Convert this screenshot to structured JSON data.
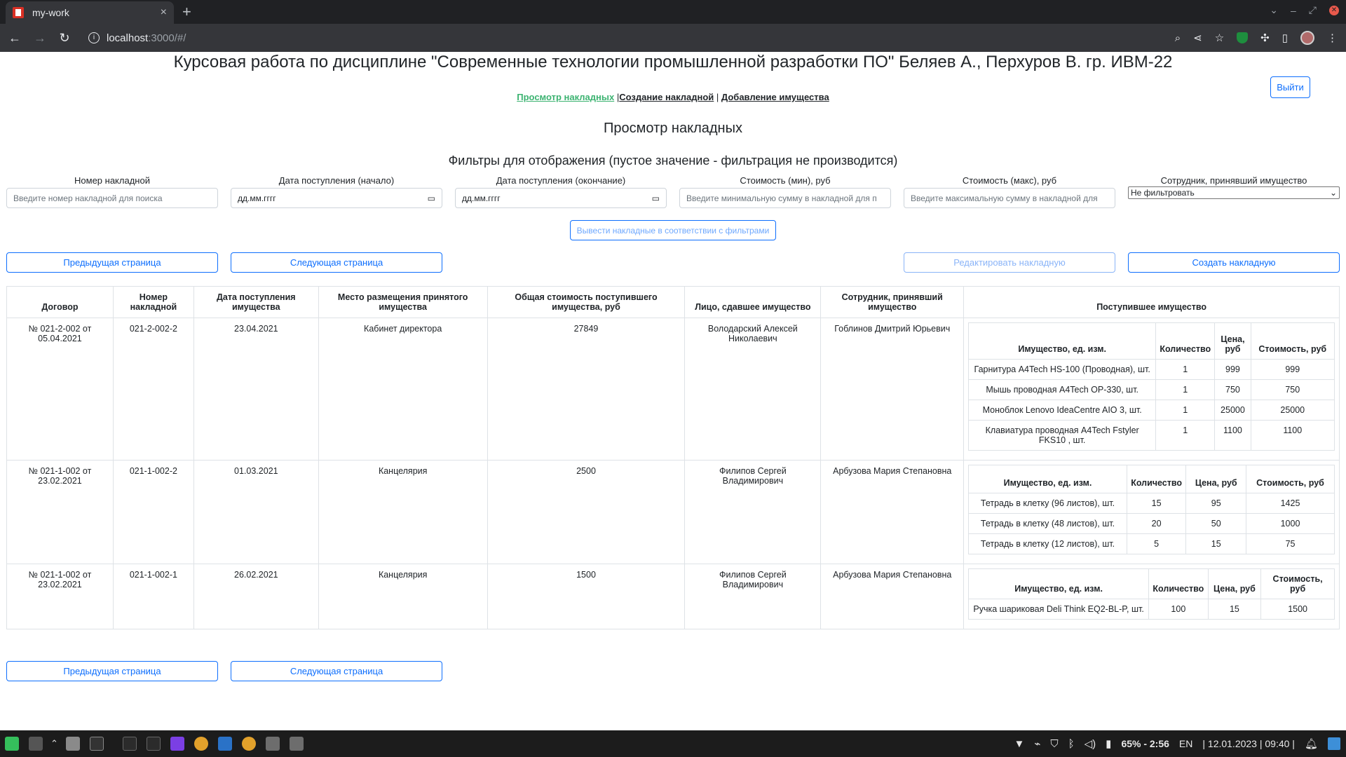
{
  "browser": {
    "tab_title": "my-work",
    "tab_close": "×",
    "new_tab": "+",
    "url_host": "localhost",
    "url_path": ":3000/#/"
  },
  "page": {
    "title": "Курсовая работа по дисциплине \"Современные технологии промышленной разработки ПО\" Беляев А., Перхуров В. гр. ИВМ-22",
    "logout_label": "Выйти",
    "nav": {
      "view": "Просмотр накладных",
      "separator1": "|",
      "create": "Создание накладной",
      "separator2": "|",
      "add_property": "Добавление имущества"
    },
    "section_title": "Просмотр накладных",
    "filters_title": "Фильтры для отображения (пустое значение - фильтрация не производится)"
  },
  "filters": {
    "number": {
      "label": "Номер накладной",
      "placeholder": "Введите номер накладной для поиска"
    },
    "date_start": {
      "label": "Дата поступления (начало)",
      "value": "дд.мм.гггг"
    },
    "date_end": {
      "label": "Дата поступления (окончание)",
      "value": "дд.мм.гггг"
    },
    "cost_min": {
      "label": "Стоимость (мин), руб",
      "placeholder": "Введите минимальную сумму в накладной для п"
    },
    "cost_max": {
      "label": "Стоимость (макс), руб",
      "placeholder": "Введите максимальную сумму в накладной для"
    },
    "employee": {
      "label": "Сотрудник, принявший имущество",
      "selected": "Не фильтровать"
    },
    "apply_label": "Вывести накладные в соответствии с фильтрами"
  },
  "buttons": {
    "prev": "Предыдущая страница",
    "next": "Следующая страница",
    "edit": "Редактировать накладную",
    "create": "Создать накладную"
  },
  "table": {
    "headers": {
      "contract": "Договор",
      "number": "Номер накладной",
      "date": "Дата поступления имущества",
      "place": "Место размещения принятого имущества",
      "total": "Общая стоимость поступившего имущества, руб",
      "giver": "Лицо, сдавшее имущество",
      "receiver": "Сотрудник, принявший имущество",
      "items": "Поступившее имущество"
    },
    "inner_headers_a": {
      "name": "Имущество, ед. изм.",
      "qty": "Количество",
      "price": "Цена, руб",
      "cost": "Стоимость, руб"
    },
    "rows": [
      {
        "contract": "№ 021-2-002 от 05.04.2021",
        "number": "021-2-002-2",
        "date": "23.04.2021",
        "place": "Кабинет директора",
        "total": "27849",
        "giver": "Володарский Алексей Николаевич",
        "receiver": "Гоблинов Дмитрий Юрьевич",
        "items": [
          {
            "name": "Гарнитура A4Tech HS-100 (Проводная), шт.",
            "qty": "1",
            "price": "999",
            "cost": "999"
          },
          {
            "name": "Мышь проводная A4Tech OP-330, шт.",
            "qty": "1",
            "price": "750",
            "cost": "750"
          },
          {
            "name": "Моноблок Lenovo IdeaCentre AIO 3, шт.",
            "qty": "1",
            "price": "25000",
            "cost": "25000"
          },
          {
            "name": "Клавиатура проводная A4Tech Fstyler FKS10 , шт.",
            "qty": "1",
            "price": "1100",
            "cost": "1100"
          }
        ]
      },
      {
        "contract": "№ 021-1-002 от 23.02.2021",
        "number": "021-1-002-2",
        "date": "01.03.2021",
        "place": "Канцелярия",
        "total": "2500",
        "giver": "Филипов Сергей Владимирович",
        "receiver": "Арбузова Мария Степановна",
        "items": [
          {
            "name": "Тетрадь в клетку (96 листов), шт.",
            "qty": "15",
            "price": "95",
            "cost": "1425"
          },
          {
            "name": "Тетрадь в клетку (48 листов), шт.",
            "qty": "20",
            "price": "50",
            "cost": "1000"
          },
          {
            "name": "Тетрадь в клетку (12 листов), шт.",
            "qty": "5",
            "price": "15",
            "cost": "75"
          }
        ]
      },
      {
        "contract": "№ 021-1-002 от 23.02.2021",
        "number": "021-1-002-1",
        "date": "26.02.2021",
        "place": "Канцелярия",
        "total": "1500",
        "giver": "Филипов Сергей Владимирович",
        "receiver": "Арбузова Мария Степановна",
        "items": [
          {
            "name": "Ручка шариковая Deli Think EQ2-BL-P, шт.",
            "qty": "100",
            "price": "15",
            "cost": "1500"
          }
        ]
      }
    ]
  },
  "taskbar": {
    "battery": "65% - 2:56",
    "lang": "EN",
    "datetime": "| 12.01.2023 | 09:40 |"
  }
}
